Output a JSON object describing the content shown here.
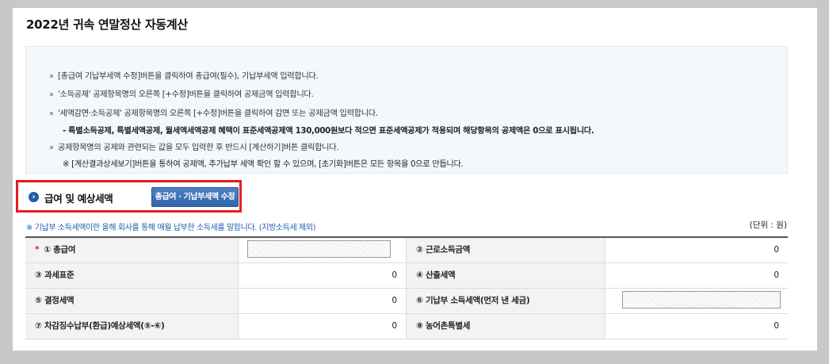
{
  "page_title": "2022년 귀속 연말정산 자동계산",
  "notice": {
    "items": [
      "[총급여 기납부세액 수정]버튼을 클릭하여 총급여(필수), 기납부세액 입력합니다.",
      "'소득공제' 공제항목명의 오른쪽 [+수정]버튼을 클릭하여 공제금액 입력합니다.",
      "'세액감면·소득공제' 공제항목명의 오른쪽 [+수정]버튼을 클릭하여 감면 또는 공제금액 입력합니다.",
      "공제항목명의 공제와 관련되는 값을 모두 입력한 후 반드시 [계산하기]버튼 클릭합니다."
    ],
    "sub_1": "- 특별소득공제, 특별세액공제, 월세액세액공제 혜택이 표준세액공제액 130,000원보다 적으면 표준세액공제가 적용되며 해당항목의 공제액은 0으로 표시됩니다.",
    "sub_2": "※ [계산결과상세보기]버튼을 통하여 공제액, 추가납부 세액 확인 할 수 있으며, [초기화]버튼은 모든 항목을 0으로 만듭니다."
  },
  "section": {
    "title": "급여 및 예상세액",
    "edit_button": "총급여 · 기납부세액 수정"
  },
  "hint": "※ 기납부 소득세액이란 올해 회사를 통해 매월 납부한 소득세를 말합니다. (지방소득세 제외)",
  "unit": "(단위 : 원)",
  "table": {
    "rows": [
      {
        "left_label": "① 총급여",
        "left_value": "",
        "right_label": "② 근로소득금액",
        "right_value": "0"
      },
      {
        "left_label": "③ 과세표준",
        "left_value": "0",
        "right_label": "④ 산출세액",
        "right_value": "0"
      },
      {
        "left_label": "⑤ 결정세액",
        "left_value": "0",
        "right_label": "⑥ 기납부 소득세액(먼저 낸 세금)",
        "right_value": ""
      },
      {
        "left_label": "⑦ 차감징수납부(환급)예상세액(⑤-⑥)",
        "left_value": "0",
        "right_label": "⑧ 농어촌특별세",
        "right_value": "0"
      }
    ],
    "required_mark": "*"
  },
  "colors": {
    "accent": "#1f5fa8",
    "highlight_border": "#e41e1e",
    "button": "#3466ad"
  }
}
